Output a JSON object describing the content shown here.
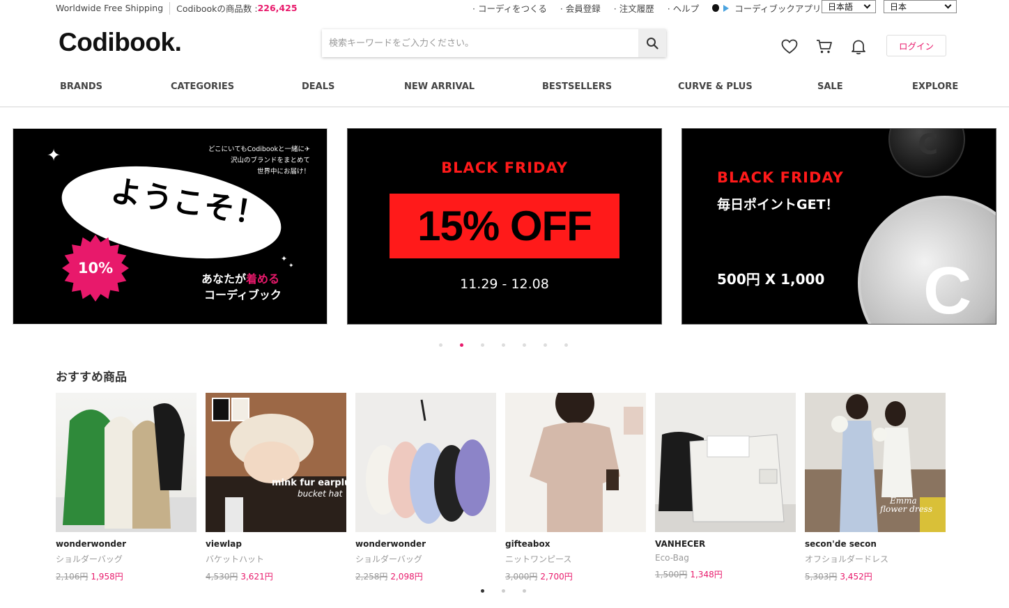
{
  "topbar": {
    "shipping": "Worldwide Free Shipping",
    "product_count_label": "Codibookの商品数 : ",
    "product_count": "226,425",
    "links": [
      "· コーディをつくる",
      "· 会員登録",
      "· 注文履歴",
      "· ヘルプ"
    ],
    "app_label": "コーディブックアプリ",
    "language": "日本語",
    "country": "日本"
  },
  "header": {
    "logo": "Codibook.",
    "search_placeholder": "検索キーワードをご入力ください。",
    "login": "ログイン"
  },
  "nav": {
    "items": [
      "BRANDS",
      "CATEGORIES",
      "DEALS",
      "NEW ARRIVAL",
      "BESTSELLERS",
      "CURVE & PLUS",
      "SALE",
      "EXPLORE"
    ]
  },
  "banners": [
    {
      "tagline": [
        "どこにいてもCodibookと一緒に✈",
        "沢山のブランドをまとめて",
        "世界中にお届け！"
      ],
      "welcome": "ようこそ！",
      "badge": "10%",
      "line1_pre": "あなたが",
      "line1_pink": "着める",
      "line2": "コーディブック"
    },
    {
      "headline": "BLACK FRIDAY",
      "offer": "15% OFF",
      "dates": "11.29 - 12.08"
    },
    {
      "headline": "BLACK FRIDAY",
      "sub": "毎日ポイントGET！",
      "amount": "500円 X 1,000",
      "coin_letter": "C"
    }
  ],
  "banner_dots": {
    "count": 7,
    "active": 1
  },
  "recommended": {
    "title": "おすすめ商品",
    "products": [
      {
        "brand": "wonderwonder",
        "name": "ショルダーバッグ",
        "original": "2,106円",
        "price": "1,958円"
      },
      {
        "brand": "viewlap",
        "name": "バケットハット",
        "original": "4,530円",
        "price": "3,621円",
        "image_text": [
          "mink fur earplug",
          "bucket hat"
        ]
      },
      {
        "brand": "wonderwonder",
        "name": "ショルダーバッグ",
        "original": "2,258円",
        "price": "2,098円"
      },
      {
        "brand": "gifteabox",
        "name": "ニットワンピース",
        "original": "3,000円",
        "price": "2,700円"
      },
      {
        "brand": "VANHECER",
        "name": "Eco-Bag",
        "original": "1,500円",
        "price": "1,348円"
      },
      {
        "brand": "secon'de secon",
        "name": "オフショルダードレス",
        "original": "5,303円",
        "price": "3,452円",
        "image_text": [
          "Emma",
          "flower dress"
        ]
      }
    ]
  },
  "product_dots": {
    "count": 3,
    "active": 0
  },
  "colors": {
    "accent": "#e8196b",
    "banner_red": "#ff1a1a"
  },
  "icons": [
    "heart-icon",
    "cart-icon",
    "bell-icon",
    "search-icon",
    "apple-icon",
    "play-store-icon",
    "chevron-down-icon"
  ]
}
